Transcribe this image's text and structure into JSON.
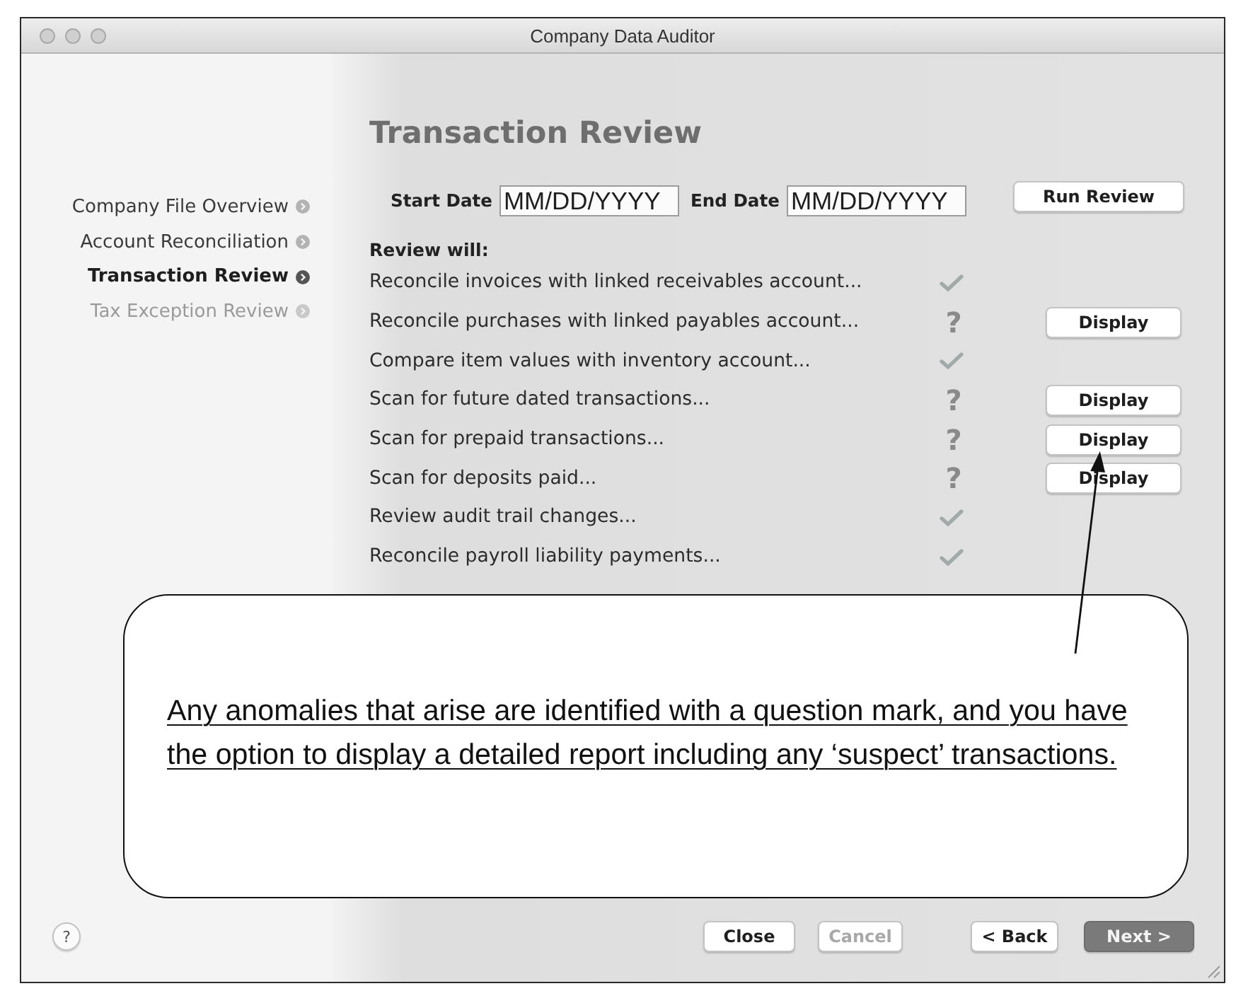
{
  "window": {
    "title": "Company Data Auditor"
  },
  "steps": [
    {
      "label": "Company File Overview",
      "selected": false,
      "disabled": false
    },
    {
      "label": "Account Reconciliation",
      "selected": false,
      "disabled": false
    },
    {
      "label": "Transaction Review",
      "selected": true,
      "disabled": false
    },
    {
      "label": "Tax Exception Review",
      "selected": false,
      "disabled": true
    }
  ],
  "page_title": "Transaction Review",
  "date_range": {
    "start_label": "Start Date",
    "start_placeholder": "MM/DD/YYYY",
    "end_label": "End Date",
    "end_placeholder": "MM/DD/YYYY"
  },
  "run_button": "Run Review",
  "review_heading": "Review will:",
  "checks": [
    {
      "label": "Reconcile invoices with linked receivables account...",
      "kind": "passed"
    },
    {
      "label": "Reconcile purchases with linked payables account...",
      "kind": "flagged",
      "mark": "?",
      "action": "Display"
    },
    {
      "label": "Compare item values with inventory account...",
      "kind": "passed"
    },
    {
      "label": "Scan for future dated transactions...",
      "kind": "flagged",
      "mark": "?",
      "action": "Display"
    },
    {
      "label": "Scan for prepaid transactions...",
      "kind": "flagged",
      "mark": "?",
      "action": "Display"
    },
    {
      "label": "Scan for deposits paid...",
      "kind": "flagged",
      "mark": "?",
      "action": "Display"
    },
    {
      "label": "Review audit trail changes...",
      "kind": "passed"
    },
    {
      "label": "Reconcile payroll liability payments...",
      "kind": "passed"
    }
  ],
  "callout": {
    "text": "Any anomalies that arise are identified with a question mark, and you have the option to display a detailed report including any ‘suspect’ transactions."
  },
  "help_button": "?",
  "footer": {
    "left_buttons": [
      {
        "label": "Close",
        "disabled": false
      },
      {
        "label": "Cancel",
        "disabled": true
      }
    ],
    "right_buttons": [
      {
        "label": "< Back",
        "default": false
      },
      {
        "label": "Next >",
        "default": true
      }
    ]
  }
}
